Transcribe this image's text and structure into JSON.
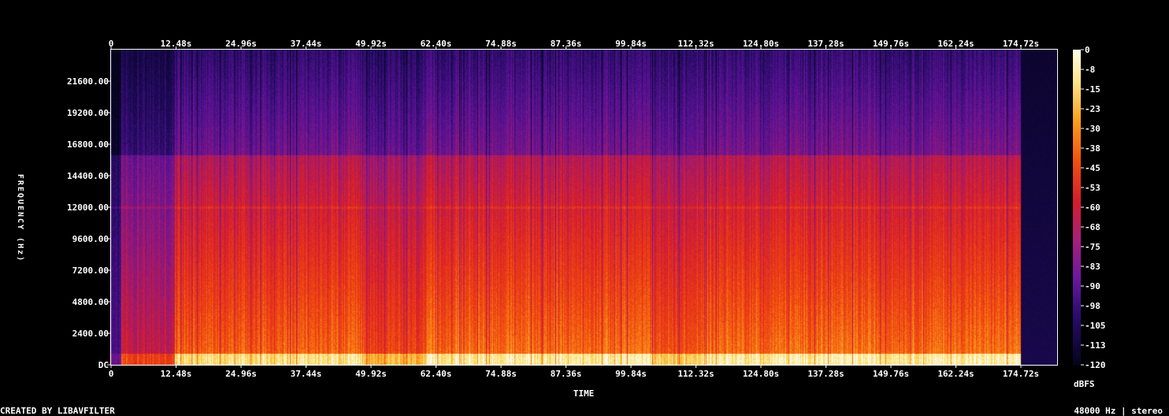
{
  "footer": {
    "left": "CREATED BY LIBAVFILTER",
    "right": "48000 Hz | stereo"
  },
  "colors": {
    "background": "#000000",
    "text": "#ffffff",
    "palette": [
      "#05041a",
      "#1a0a4a",
      "#4a108c",
      "#7a1aa0",
      "#b0207a",
      "#d8242c",
      "#f03a10",
      "#f88a10",
      "#fcd040",
      "#fff8d0"
    ]
  },
  "chart_data": {
    "type": "heatmap",
    "title": "",
    "xlabel": "TIME",
    "ylabel": "FREQUENCY (Hz)",
    "xlim": [
      0,
      187.2
    ],
    "ylim": [
      0,
      24000
    ],
    "x_ticks": [
      "0",
      "12.48s",
      "24.96s",
      "37.44s",
      "49.92s",
      "62.40s",
      "74.88s",
      "87.36s",
      "99.84s",
      "112.32s",
      "124.80s",
      "137.28s",
      "149.76s",
      "162.24s",
      "174.72s"
    ],
    "y_ticks": [
      "DC",
      "2400.00",
      "4800.00",
      "7200.00",
      "9600.00",
      "12000.00",
      "14400.00",
      "16800.00",
      "19200.00",
      "21600.00"
    ],
    "colorbar": {
      "label": "dBFS",
      "range": [
        -120,
        0
      ],
      "ticks": [
        "0",
        "-8",
        "-15",
        "-23",
        "-30",
        "-38",
        "-45",
        "-53",
        "-60",
        "-68",
        "-75",
        "-83",
        "-90",
        "-98",
        "-105",
        "-113",
        "-120"
      ]
    },
    "segments": [
      {
        "start": 0,
        "end": 2,
        "level": -95
      },
      {
        "start": 2,
        "end": 4,
        "level": -70
      },
      {
        "start": 4,
        "end": 12.48,
        "level": -72
      },
      {
        "start": 12.48,
        "end": 49.92,
        "level": -52
      },
      {
        "start": 49.92,
        "end": 62.4,
        "level": -58
      },
      {
        "start": 62.4,
        "end": 107,
        "level": -50
      },
      {
        "start": 107,
        "end": 117,
        "level": -55
      },
      {
        "start": 117,
        "end": 180,
        "level": -50
      },
      {
        "start": 180,
        "end": 187.2,
        "level": -110
      }
    ],
    "notes": [
      "Spectral shelf near 16000 Hz",
      "Harmonic band near 12000 Hz",
      "Strongest energy below 2400 Hz"
    ]
  }
}
